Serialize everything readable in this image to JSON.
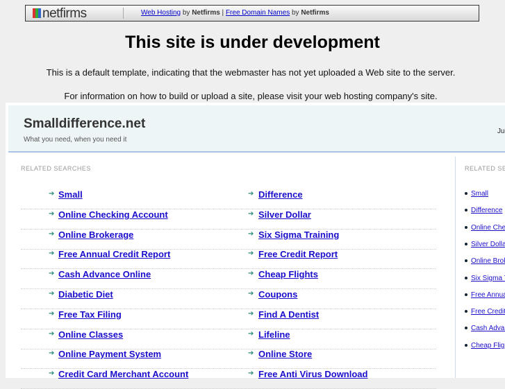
{
  "topbar": {
    "logo": "netfirms",
    "link1": "Web Hosting",
    "by1": " by ",
    "brand1": "Netfirms",
    "pipe": " | ",
    "link2": "Free Domain Names",
    "by2": " by ",
    "brand2": "Netfirms"
  },
  "heading": "This site is under development",
  "para1": "This is a default template, indicating that the webmaster has not yet uploaded a Web site to the server.",
  "para2": "For information on how to build or upload a site, please visit your web hosting company's site.",
  "site": {
    "name": "Smalldifference.net",
    "tagline": "What you need, when you need it",
    "header_right": "Ju"
  },
  "related_label": "RELATED SEARCHES",
  "left_links": [
    "Small",
    "Online Checking Account",
    "Online Brokerage",
    "Free Annual Credit Report",
    "Cash Advance Online",
    "Diabetic Diet",
    "Free Tax Filing",
    "Online Classes",
    "Online Payment System",
    "Credit Card Merchant Account"
  ],
  "right_links": [
    "Difference",
    "Silver Dollar",
    "Six Sigma Training",
    "Free Credit Report",
    "Cheap Flights",
    "Coupons",
    "Find A Dentist",
    "Lifeline",
    "Online Store",
    "Free Anti Virus Download"
  ],
  "sidebar": {
    "label": "RELATED SEARCHES",
    "links": [
      "Small",
      "Difference",
      "Online Checking Account",
      "Silver Dollar",
      "Online Brokerage",
      "Six Sigma Training",
      "Free Annual Credit Report",
      "Free Credit Report",
      "Cash Advance Online",
      "Cheap Flights"
    ]
  }
}
